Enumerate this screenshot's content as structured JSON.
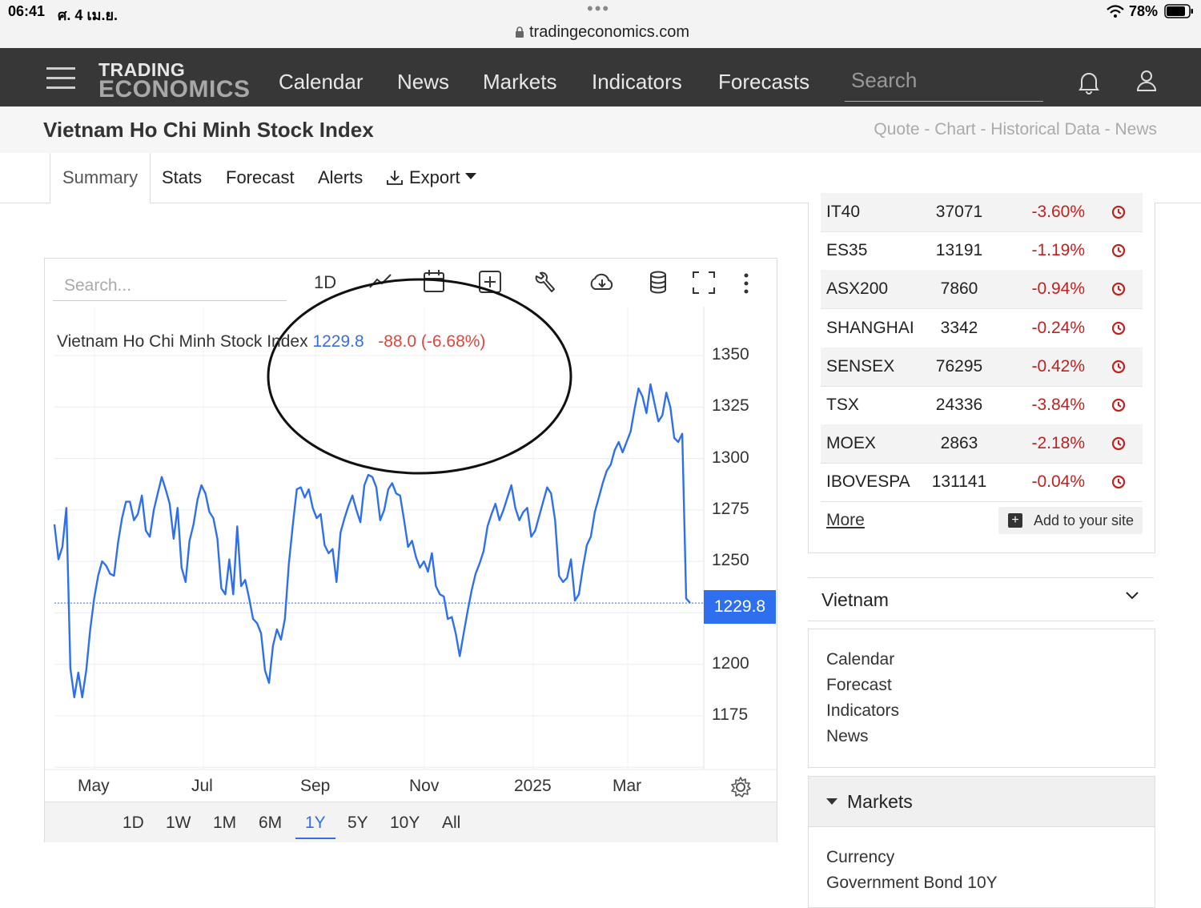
{
  "status_bar": {
    "time": "06:41",
    "date": "ศ. 4 เม.ย.",
    "url": "tradingeconomics.com",
    "battery": "78%"
  },
  "nav": {
    "logo_top": "TRADING",
    "logo_bottom": "ECONOMICS",
    "items": [
      "Calendar",
      "News",
      "Markets",
      "Indicators",
      "Forecasts"
    ],
    "search_placeholder": "Search"
  },
  "page": {
    "title": "Vietnam Ho Chi Minh Stock Index",
    "breadcrumb_links": "Quote - Chart - Historical Data - News"
  },
  "tabs": {
    "summary": "Summary",
    "stats": "Stats",
    "forecast": "Forecast",
    "alerts": "Alerts",
    "export": "Export"
  },
  "chart_toolbar": {
    "search_placeholder": "Search...",
    "interval": "1D"
  },
  "chart_legend": {
    "name": "Vietnam Ho Chi Minh Stock Index",
    "price": "1229.8",
    "change": "-88.0 (-6.68%)"
  },
  "range_buttons": [
    "1D",
    "1W",
    "1M",
    "6M",
    "1Y",
    "5Y",
    "10Y",
    "All"
  ],
  "range_selected": "1Y",
  "chart_data": {
    "type": "line",
    "series": [
      {
        "values": [
          1268,
          1251,
          1257,
          1276,
          1198,
          1184,
          1196,
          1184,
          1197,
          1217,
          1232,
          1243,
          1250,
          1248,
          1244,
          1243,
          1259,
          1271,
          1279,
          1279,
          1270,
          1273,
          1282,
          1265,
          1262,
          1275,
          1283,
          1291,
          1285,
          1278,
          1261,
          1276,
          1247,
          1240,
          1260,
          1268,
          1280,
          1287,
          1283,
          1274,
          1271,
          1261,
          1237,
          1234,
          1251,
          1234,
          1267,
          1238,
          1241,
          1232,
          1222,
          1220,
          1215,
          1197,
          1191,
          1209,
          1217,
          1212,
          1222,
          1249,
          1268,
          1285,
          1286,
          1281,
          1285,
          1276,
          1271,
          1273,
          1258,
          1254,
          1256,
          1240,
          1264,
          1271,
          1277,
          1282,
          1275,
          1269,
          1287,
          1292,
          1291,
          1286,
          1270,
          1275,
          1285,
          1288,
          1283,
          1282,
          1270,
          1257,
          1260,
          1252,
          1247,
          1250,
          1245,
          1254,
          1238,
          1234,
          1233,
          1222,
          1223,
          1215,
          1204,
          1215,
          1226,
          1236,
          1244,
          1249,
          1255,
          1267,
          1273,
          1278,
          1270,
          1275,
          1281,
          1287,
          1276,
          1270,
          1274,
          1276,
          1262,
          1265,
          1272,
          1279,
          1286,
          1283,
          1270,
          1243,
          1240,
          1242,
          1251,
          1231,
          1234,
          1247,
          1258,
          1262,
          1274,
          1281,
          1288,
          1294,
          1297,
          1304,
          1308,
          1303,
          1308,
          1313,
          1324,
          1334,
          1330,
          1322,
          1336,
          1327,
          1318,
          1321,
          1332,
          1325,
          1310,
          1308,
          1312,
          1232,
          1229.8
        ],
        "start": "2024-04-04",
        "end": "2025-04-04"
      }
    ],
    "x_ticks": [
      "May",
      "Jul",
      "Sep",
      "Nov",
      "2025",
      "Mar"
    ],
    "y_ticks": [
      1350,
      1325,
      1300,
      1275,
      1250,
      1200,
      1175
    ],
    "ylim": [
      1155,
      1360
    ],
    "last_value_label": "1229.8",
    "color": "#2e6ff0",
    "grid": true
  },
  "markets_table": [
    {
      "symbol": "IT40",
      "value": "37071",
      "change": "-3.60%"
    },
    {
      "symbol": "ES35",
      "value": "13191",
      "change": "-1.19%"
    },
    {
      "symbol": "ASX200",
      "value": "7860",
      "change": "-0.94%"
    },
    {
      "symbol": "SHANGHAI",
      "value": "3342",
      "change": "-0.24%"
    },
    {
      "symbol": "SENSEX",
      "value": "76295",
      "change": "-0.42%"
    },
    {
      "symbol": "TSX",
      "value": "24336",
      "change": "-3.84%"
    },
    {
      "symbol": "MOEX",
      "value": "2863",
      "change": "-2.18%"
    },
    {
      "symbol": "IBOVESPA",
      "value": "131141",
      "change": "-0.04%"
    }
  ],
  "markets_footer": {
    "more": "More",
    "add": "Add to your site"
  },
  "country": {
    "label": "Vietnam",
    "links": [
      "Calendar",
      "Forecast",
      "Indicators",
      "News"
    ]
  },
  "markets_section": {
    "label": "Markets",
    "links": [
      "Currency",
      "Government Bond 10Y"
    ]
  },
  "colors": {
    "nav_bg": "#373737",
    "accent": "#2e6ff0",
    "negative": "#c0211f"
  }
}
